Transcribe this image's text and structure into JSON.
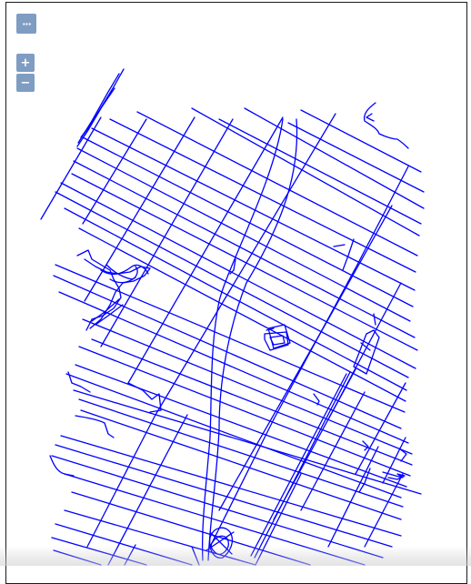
{
  "map": {
    "line_color": "#0000ff",
    "background_color": "#ffffff"
  },
  "controls": {
    "menu": {
      "icon": "ellipsis-icon",
      "label": "···"
    },
    "zoom_in": {
      "icon": "plus-icon",
      "label": "+"
    },
    "zoom_out": {
      "icon": "minus-icon",
      "label": "−"
    },
    "button_color": "#7f9dc3"
  }
}
